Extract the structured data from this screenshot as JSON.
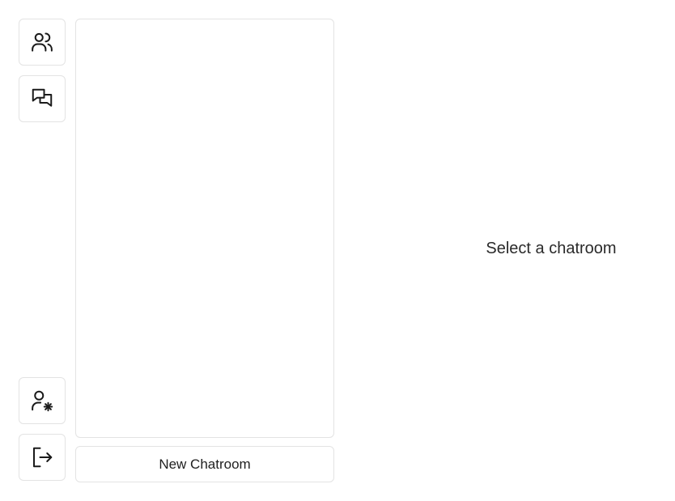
{
  "sidebar": {
    "top_buttons": [
      {
        "name": "users",
        "icon": "users-icon"
      },
      {
        "name": "chatrooms",
        "icon": "chat-bubbles-icon"
      }
    ],
    "bottom_buttons": [
      {
        "name": "profile-settings",
        "icon": "user-settings-icon"
      },
      {
        "name": "logout",
        "icon": "logout-icon"
      }
    ]
  },
  "chatroom_list": {
    "items": [],
    "new_button_label": "New Chatroom"
  },
  "main": {
    "empty_state_text": "Select a chatroom"
  },
  "colors": {
    "border": "#e3e3e3",
    "background": "#ffffff",
    "text": "#222222"
  }
}
